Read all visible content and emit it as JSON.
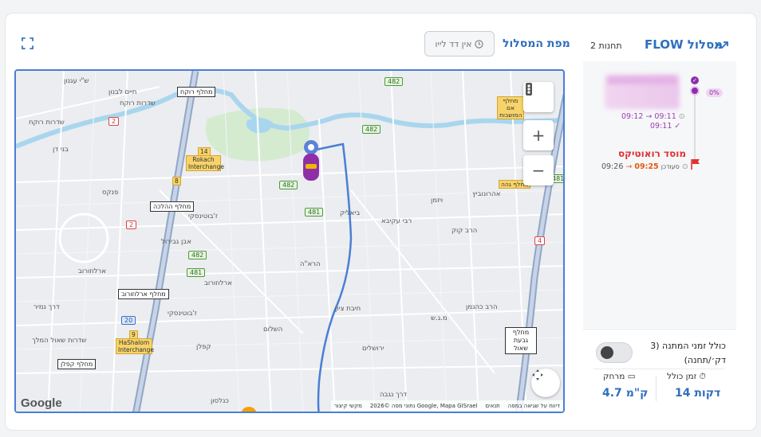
{
  "header": {
    "map_title": "מפת המסלול",
    "live_button": "אין דד לייו",
    "flow_title": "FLOW מסלול",
    "stations": "2 תחנות"
  },
  "timeline": {
    "progress": "0%",
    "stop1_times": "09:12 → 09:11",
    "stop1_actual": "09:11",
    "destination": "מוסד רואוטיקס",
    "destination_times_planned": "09:26",
    "destination_times_late": "09:25",
    "destination_late_label": "סעודכן"
  },
  "stats": {
    "toggle_label": "כולל זמני המתנה (3 דק׳/תחנה)",
    "total_time_label": "זמן כולל",
    "total_time_value": "14 דקות",
    "distance_label": "מרחק",
    "distance_value": "4.7 ק\"מ",
    "include_wait": false
  },
  "map": {
    "interchanges": [
      {
        "id": "rokach",
        "text": "מחלף רוקח"
      },
      {
        "id": "halacha",
        "text": "מחלף ההלכה"
      },
      {
        "id": "arlozorov",
        "text": "מחלף ארלוזורוב"
      },
      {
        "id": "kaplan",
        "text": "מחלף קפלן"
      },
      {
        "id": "givat",
        "text": "מחלף גבעת שאול"
      },
      {
        "id": "am",
        "text": "מחלף אם המושבות"
      },
      {
        "id": "geha",
        "text": "מחלף גהה"
      }
    ],
    "ylabels": {
      "rokach_num": "14",
      "rokach": "Rokach Interchange",
      "hashalom_num": "9",
      "hashalom": "HaShalom Interchange",
      "small8": "8"
    },
    "streets": {
      "s1": "ש\"י עגנון",
      "s2": "חיים לבנון",
      "s3": "שדרות רוקח",
      "s4": "שדרות רוקח",
      "s5": "בני דן",
      "s6": "פנקס",
      "s7": "ז'בוטינסקי",
      "s8": "אבן גבירול",
      "s9": "ארלוזורוב",
      "s10": "ארלוזורוב",
      "s11": "שדרות שאול המלך",
      "s12": "דרך נמיר",
      "s13": "קפלן",
      "s14": "הרא\"ה",
      "s15": "ביאליק",
      "s16": "ז'בוטינסקי",
      "s17": "רבי עקיבא",
      "s18": "חיבת ציון",
      "s19": "ירושלים",
      "s20": "השלום",
      "s21": "דרך נגבה",
      "s22": "כנלסון",
      "s23": "ז'בוטינסקי",
      "s24": "הרב כהנמן",
      "s25": "אהרונוביץ",
      "s26": "ויזמן",
      "s27": "שדרות ירושלים",
      "s28": "מ.ג.ש",
      "s29": "הרב קוק",
      "s30": "רחוב השלום",
      "s31": "נתן ירושלים",
      "s32": "ג'ורג"
    },
    "shields": {
      "r482a": "482",
      "r482b": "482",
      "r482c": "482",
      "r482d": "482",
      "r481a": "481",
      "r481b": "481",
      "r481c": "481",
      "r2a": "2",
      "r2b": "2",
      "r4": "4",
      "r20": "20"
    },
    "google": "Google",
    "attribution": [
      "דיווח על שגיאה במפה",
      "תנאים",
      "נתוני מפה ©2026 Google, Mapa GISrael",
      "מקשי קיצור"
    ]
  },
  "colors": {
    "accent": "#2f6fbd",
    "route": "#4a7fd4",
    "purple": "#8e2fa8",
    "destination": "#e03131"
  }
}
